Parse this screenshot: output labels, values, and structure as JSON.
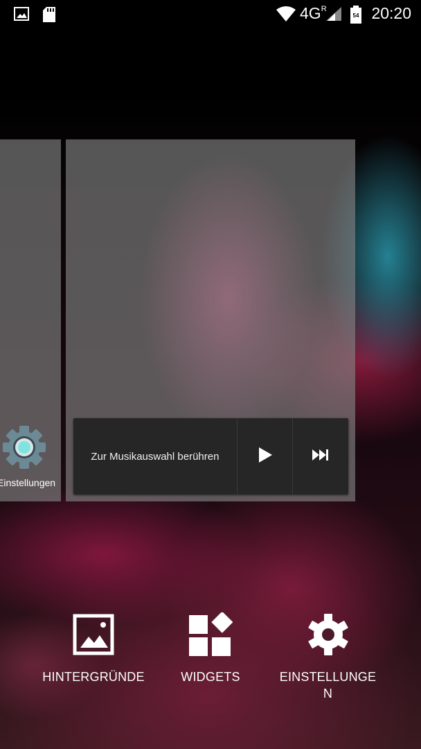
{
  "status_bar": {
    "time": "20:20",
    "network": "4G",
    "network_superscript": "R",
    "battery_level": "54",
    "icons": [
      "image-icon",
      "sd-card-icon",
      "wifi-icon",
      "signal-icon",
      "battery-icon"
    ]
  },
  "home": {
    "left_app_label": "Einstellungen",
    "music_widget": {
      "prompt": "Zur Musikauswahl berühren",
      "play_icon": "play-icon",
      "next_icon": "skip-next-icon"
    }
  },
  "options": [
    {
      "label": "HINTERGRÜNDE",
      "icon": "wallpaper-icon"
    },
    {
      "label": "WIDGETS",
      "icon": "widgets-icon"
    },
    {
      "label": "EINSTELLUNGEN",
      "icon": "gear-icon"
    }
  ],
  "colors": {
    "widget_bg": "#262626",
    "card_overlay": "rgba(130,130,130,0.65)",
    "settings_icon_accent": "#7fe3e0"
  }
}
